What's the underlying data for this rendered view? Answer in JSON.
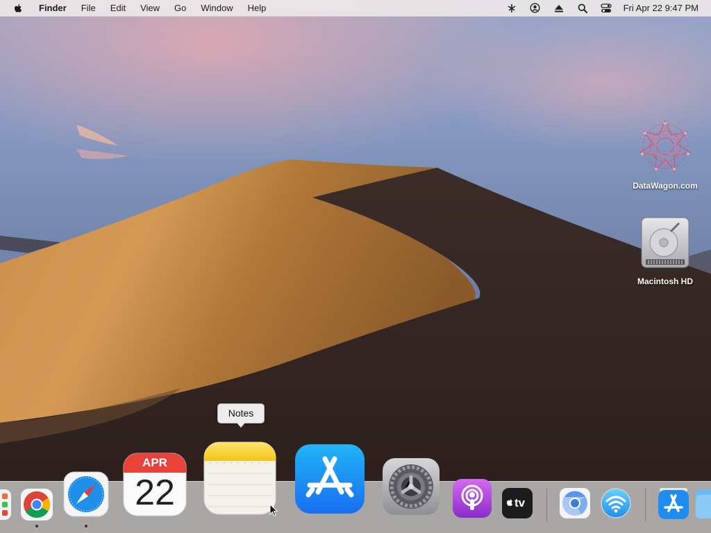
{
  "menubar": {
    "app_name": "Finder",
    "menus": [
      "File",
      "Edit",
      "View",
      "Go",
      "Window",
      "Help"
    ],
    "clock": "Fri Apr 22  9:47 PM",
    "status_icons": [
      "network-icon",
      "user-icon",
      "eject-icon",
      "search-icon",
      "control-center-icon"
    ]
  },
  "desktop": {
    "items": [
      {
        "label": "DataWagon.com",
        "icon": "datawagon-icon"
      },
      {
        "label": "Macintosh HD",
        "icon": "hard-drive-icon"
      }
    ]
  },
  "dock": {
    "calendar": {
      "month": "APR",
      "day": "22"
    },
    "tooltip": "Notes",
    "apps": [
      {
        "name": "Launchpad",
        "running": false
      },
      {
        "name": "Chrome",
        "running": true
      },
      {
        "name": "Safari",
        "running": true
      },
      {
        "name": "Calendar",
        "running": false
      },
      {
        "name": "Notes",
        "running": false
      },
      {
        "name": "App Store",
        "running": false
      },
      {
        "name": "System Preferences",
        "running": false
      },
      {
        "name": "Podcasts",
        "running": false
      },
      {
        "name": "Apple TV",
        "running": false
      },
      {
        "name": "Chromium",
        "running": false
      },
      {
        "name": "Wireless Diagnostics",
        "running": false
      },
      {
        "name": "App Store Downloads",
        "running": false
      },
      {
        "name": "Folder",
        "running": false
      }
    ],
    "tv_label": "tv"
  },
  "colors": {
    "menubar_bg": "#ece8e8",
    "dock_bg": "#cdcdcd",
    "app_store_blue": "#1a8cf0",
    "podcasts_purple": "#9b3fd6",
    "calendar_red": "#e8433a",
    "notes_yellow": "#f8d03a"
  }
}
